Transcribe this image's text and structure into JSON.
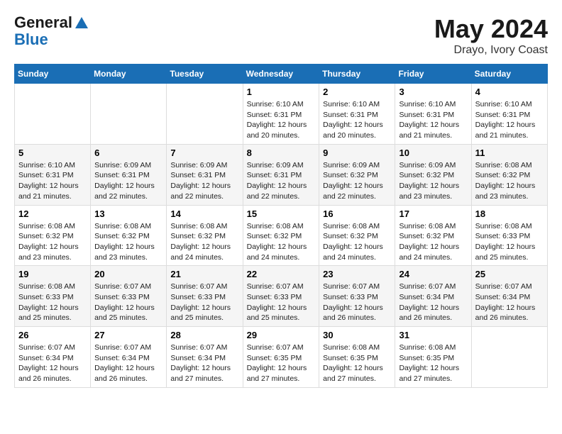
{
  "header": {
    "logo_line1": "General",
    "logo_line2": "Blue",
    "title": "May 2024",
    "subtitle": "Drayo, Ivory Coast"
  },
  "weekdays": [
    "Sunday",
    "Monday",
    "Tuesday",
    "Wednesday",
    "Thursday",
    "Friday",
    "Saturday"
  ],
  "weeks": [
    [
      {
        "day": "",
        "info": ""
      },
      {
        "day": "",
        "info": ""
      },
      {
        "day": "",
        "info": ""
      },
      {
        "day": "1",
        "info": "Sunrise: 6:10 AM\nSunset: 6:31 PM\nDaylight: 12 hours and 20 minutes."
      },
      {
        "day": "2",
        "info": "Sunrise: 6:10 AM\nSunset: 6:31 PM\nDaylight: 12 hours and 20 minutes."
      },
      {
        "day": "3",
        "info": "Sunrise: 6:10 AM\nSunset: 6:31 PM\nDaylight: 12 hours and 21 minutes."
      },
      {
        "day": "4",
        "info": "Sunrise: 6:10 AM\nSunset: 6:31 PM\nDaylight: 12 hours and 21 minutes."
      }
    ],
    [
      {
        "day": "5",
        "info": "Sunrise: 6:10 AM\nSunset: 6:31 PM\nDaylight: 12 hours and 21 minutes."
      },
      {
        "day": "6",
        "info": "Sunrise: 6:09 AM\nSunset: 6:31 PM\nDaylight: 12 hours and 22 minutes."
      },
      {
        "day": "7",
        "info": "Sunrise: 6:09 AM\nSunset: 6:31 PM\nDaylight: 12 hours and 22 minutes."
      },
      {
        "day": "8",
        "info": "Sunrise: 6:09 AM\nSunset: 6:31 PM\nDaylight: 12 hours and 22 minutes."
      },
      {
        "day": "9",
        "info": "Sunrise: 6:09 AM\nSunset: 6:32 PM\nDaylight: 12 hours and 22 minutes."
      },
      {
        "day": "10",
        "info": "Sunrise: 6:09 AM\nSunset: 6:32 PM\nDaylight: 12 hours and 23 minutes."
      },
      {
        "day": "11",
        "info": "Sunrise: 6:08 AM\nSunset: 6:32 PM\nDaylight: 12 hours and 23 minutes."
      }
    ],
    [
      {
        "day": "12",
        "info": "Sunrise: 6:08 AM\nSunset: 6:32 PM\nDaylight: 12 hours and 23 minutes."
      },
      {
        "day": "13",
        "info": "Sunrise: 6:08 AM\nSunset: 6:32 PM\nDaylight: 12 hours and 23 minutes."
      },
      {
        "day": "14",
        "info": "Sunrise: 6:08 AM\nSunset: 6:32 PM\nDaylight: 12 hours and 24 minutes."
      },
      {
        "day": "15",
        "info": "Sunrise: 6:08 AM\nSunset: 6:32 PM\nDaylight: 12 hours and 24 minutes."
      },
      {
        "day": "16",
        "info": "Sunrise: 6:08 AM\nSunset: 6:32 PM\nDaylight: 12 hours and 24 minutes."
      },
      {
        "day": "17",
        "info": "Sunrise: 6:08 AM\nSunset: 6:32 PM\nDaylight: 12 hours and 24 minutes."
      },
      {
        "day": "18",
        "info": "Sunrise: 6:08 AM\nSunset: 6:33 PM\nDaylight: 12 hours and 25 minutes."
      }
    ],
    [
      {
        "day": "19",
        "info": "Sunrise: 6:08 AM\nSunset: 6:33 PM\nDaylight: 12 hours and 25 minutes."
      },
      {
        "day": "20",
        "info": "Sunrise: 6:07 AM\nSunset: 6:33 PM\nDaylight: 12 hours and 25 minutes."
      },
      {
        "day": "21",
        "info": "Sunrise: 6:07 AM\nSunset: 6:33 PM\nDaylight: 12 hours and 25 minutes."
      },
      {
        "day": "22",
        "info": "Sunrise: 6:07 AM\nSunset: 6:33 PM\nDaylight: 12 hours and 25 minutes."
      },
      {
        "day": "23",
        "info": "Sunrise: 6:07 AM\nSunset: 6:33 PM\nDaylight: 12 hours and 26 minutes."
      },
      {
        "day": "24",
        "info": "Sunrise: 6:07 AM\nSunset: 6:34 PM\nDaylight: 12 hours and 26 minutes."
      },
      {
        "day": "25",
        "info": "Sunrise: 6:07 AM\nSunset: 6:34 PM\nDaylight: 12 hours and 26 minutes."
      }
    ],
    [
      {
        "day": "26",
        "info": "Sunrise: 6:07 AM\nSunset: 6:34 PM\nDaylight: 12 hours and 26 minutes."
      },
      {
        "day": "27",
        "info": "Sunrise: 6:07 AM\nSunset: 6:34 PM\nDaylight: 12 hours and 26 minutes."
      },
      {
        "day": "28",
        "info": "Sunrise: 6:07 AM\nSunset: 6:34 PM\nDaylight: 12 hours and 27 minutes."
      },
      {
        "day": "29",
        "info": "Sunrise: 6:07 AM\nSunset: 6:35 PM\nDaylight: 12 hours and 27 minutes."
      },
      {
        "day": "30",
        "info": "Sunrise: 6:08 AM\nSunset: 6:35 PM\nDaylight: 12 hours and 27 minutes."
      },
      {
        "day": "31",
        "info": "Sunrise: 6:08 AM\nSunset: 6:35 PM\nDaylight: 12 hours and 27 minutes."
      },
      {
        "day": "",
        "info": ""
      }
    ]
  ]
}
